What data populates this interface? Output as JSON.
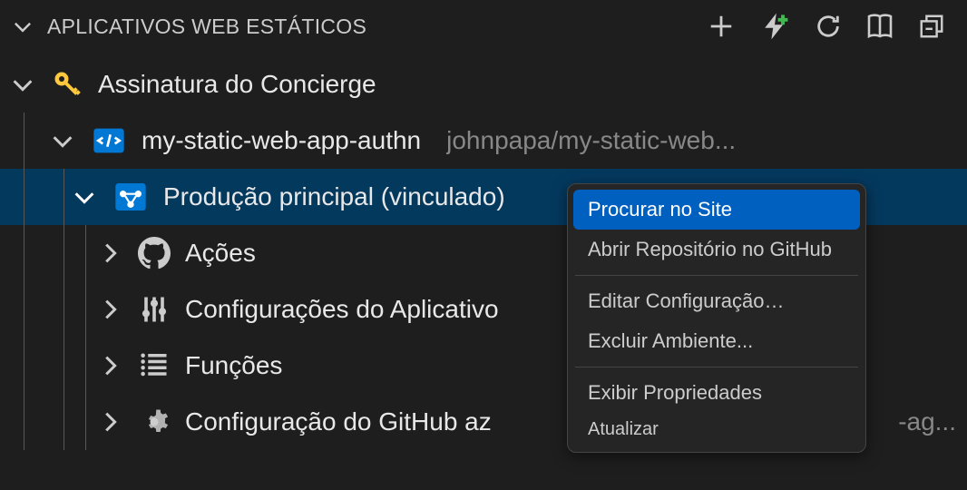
{
  "panel": {
    "title": "APLICATIVOS WEB ESTÁTICOS"
  },
  "tree": {
    "subscription": {
      "label": "Assinatura do Concierge"
    },
    "app": {
      "label": "my-static-web-app-authn",
      "description": "johnpapa/my-static-web..."
    },
    "environment": {
      "label": "Produção principal (vinculado)"
    },
    "actions": {
      "label": "Ações"
    },
    "appSettings": {
      "label": "Configurações do Aplicativo"
    },
    "functions": {
      "label": "Funções"
    },
    "githubConfig": {
      "label": "Configuração do GitHub az",
      "trailing": "-ag..."
    }
  },
  "contextMenu": {
    "browseSite": "Procurar no Site",
    "openRepo": "Abrir Repositório no GitHub",
    "editConfig": "Editar Configuração…",
    "deleteEnv": "Excluir Ambiente...",
    "showProps": "Exibir Propriedades",
    "refresh": "Atualizar"
  }
}
